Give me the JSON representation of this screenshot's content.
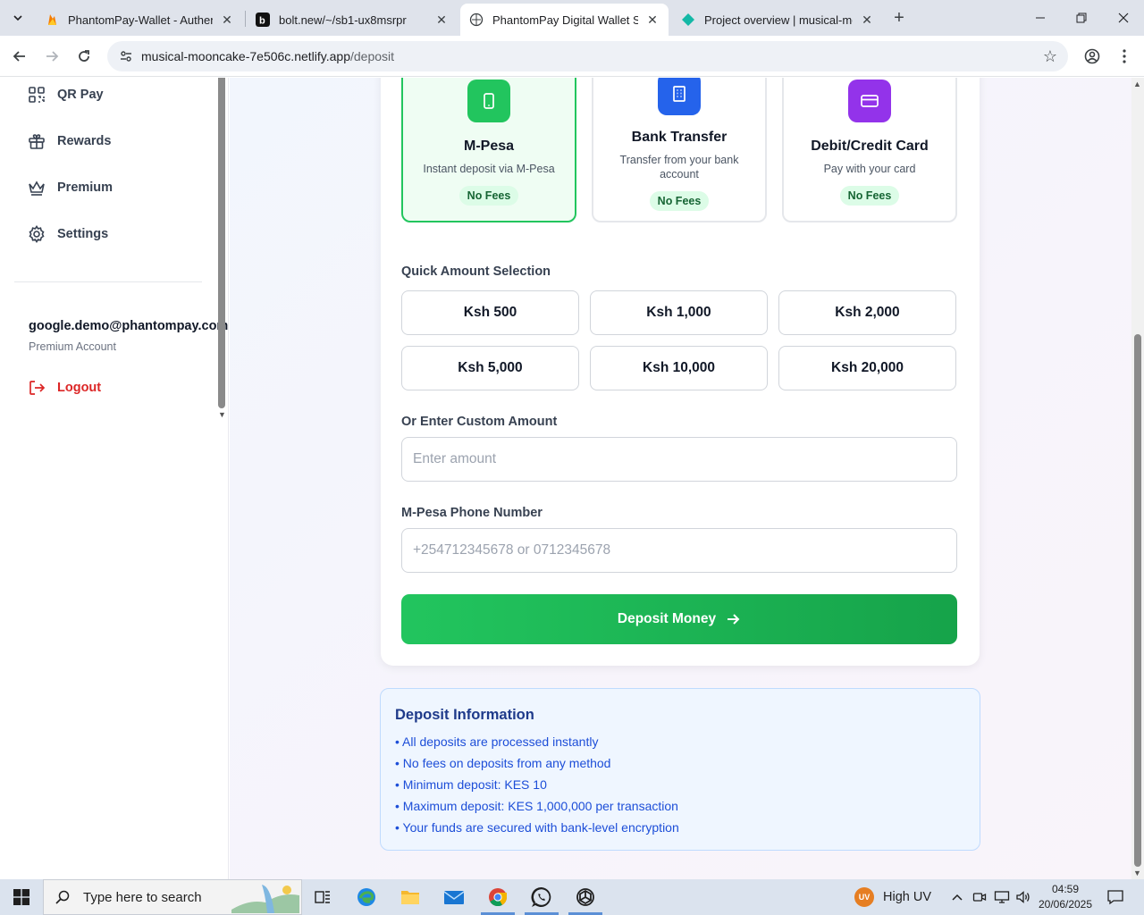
{
  "browser": {
    "tabs": [
      {
        "title": "PhantomPay-Wallet - Authentic",
        "icon": "firebase-icon",
        "active": false
      },
      {
        "title": "bolt.new/~/sb1-ux8msrpr",
        "icon": "bolt-icon",
        "active": false
      },
      {
        "title": "PhantomPay Digital Wallet Syst",
        "icon": "globe-icon",
        "active": true
      },
      {
        "title": "Project overview | musical-moo",
        "icon": "netlify-icon",
        "active": false
      }
    ],
    "url_host": "musical-mooncake-7e506c.netlify.app",
    "url_path": "/deposit"
  },
  "sidebar": {
    "items": [
      {
        "label": "QR Pay",
        "icon": "qr-icon"
      },
      {
        "label": "Rewards",
        "icon": "gift-icon"
      },
      {
        "label": "Premium",
        "icon": "crown-icon"
      },
      {
        "label": "Settings",
        "icon": "gear-icon"
      }
    ],
    "user_email": "google.demo@phantompay.com",
    "user_plan": "Premium Account",
    "logout_label": "Logout"
  },
  "deposit": {
    "methods": [
      {
        "name": "M-Pesa",
        "desc": "Instant deposit via M-Pesa",
        "fee": "No Fees",
        "selected": true,
        "color": "#22c55e",
        "icon": "phone-icon"
      },
      {
        "name": "Bank Transfer",
        "desc": "Transfer from your bank account",
        "fee": "No Fees",
        "selected": false,
        "color": "#2563eb",
        "icon": "building-icon"
      },
      {
        "name": "Debit/Credit Card",
        "desc": "Pay with your card",
        "fee": "No Fees",
        "selected": false,
        "color": "#9333ea",
        "icon": "credit-card-icon"
      }
    ],
    "quick_label": "Quick Amount Selection",
    "amounts": [
      "Ksh 500",
      "Ksh 1,000",
      "Ksh 2,000",
      "Ksh 5,000",
      "Ksh 10,000",
      "Ksh 20,000"
    ],
    "custom_label": "Or Enter Custom Amount",
    "custom_placeholder": "Enter amount",
    "phone_label": "M-Pesa Phone Number",
    "phone_placeholder": "+254712345678 or 0712345678",
    "submit_label": "Deposit Money"
  },
  "info": {
    "title": "Deposit Information",
    "items": [
      "• All deposits are processed instantly",
      "• No fees on deposits from any method",
      "• Minimum deposit: KES 10",
      "• Maximum deposit: KES 1,000,000 per transaction",
      "• Your funds are secured with bank-level encryption"
    ]
  },
  "taskbar": {
    "search_placeholder": "Type here to search",
    "weather_badge": "UV",
    "weather_text": "High UV",
    "time": "04:59",
    "date": "20/06/2025"
  }
}
